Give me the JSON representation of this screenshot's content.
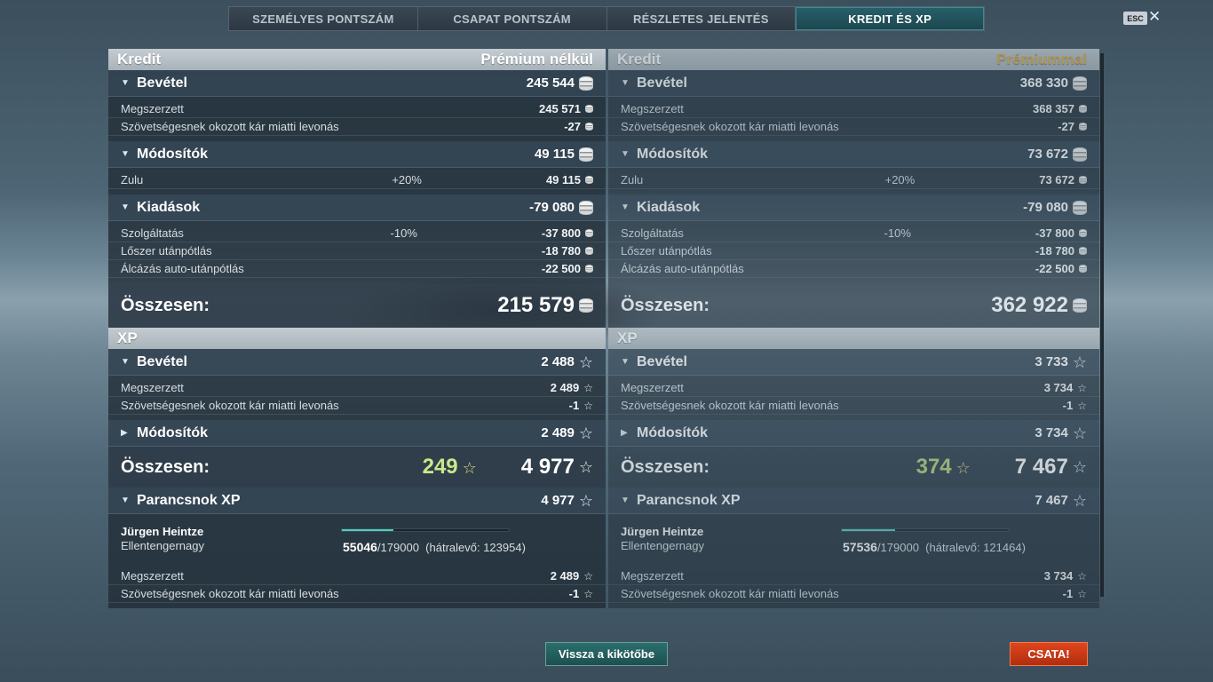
{
  "tabs": [
    {
      "label": "SZEMÉLYES PONTSZÁM",
      "active": false
    },
    {
      "label": "CSAPAT PONTSZÁM",
      "active": false
    },
    {
      "label": "RÉSZLETES JELENTÉS",
      "active": false
    },
    {
      "label": "KREDIT ÉS XP",
      "active": true
    }
  ],
  "esc": "ESC",
  "close": "✕",
  "panels": [
    {
      "kredit_title": "Kredit",
      "premium_label": "Prémium nélkül",
      "income": {
        "label": "Bevétel",
        "value": "245 544",
        "rows": [
          {
            "label": "Megszerzett",
            "value": "245 571"
          },
          {
            "label": "Szövetségesnek okozott kár miatti levonás",
            "value": "-27"
          }
        ]
      },
      "modifiers": {
        "label": "Módosítók",
        "value": "49 115",
        "rows": [
          {
            "label": "Zulu",
            "pct": "+20%",
            "value": "49 115"
          }
        ]
      },
      "expenses": {
        "label": "Kiadások",
        "value": "-79 080",
        "rows": [
          {
            "label": "Szolgáltatás",
            "pct": "-10%",
            "value": "-37 800"
          },
          {
            "label": "Lőszer utánpótlás",
            "pct": "",
            "value": "-18 780"
          },
          {
            "label": "Álcázás auto-utánpótlás",
            "pct": "",
            "value": "-22 500"
          }
        ]
      },
      "total_label": "Összesen:",
      "total_value": "215 579",
      "xp_title": "XP",
      "xp_income": {
        "label": "Bevétel",
        "value": "2 488",
        "rows": [
          {
            "label": "Megszerzett",
            "value": "2 489"
          },
          {
            "label": "Szövetségesnek okozott kár miatti levonás",
            "value": "-1"
          }
        ]
      },
      "xp_modifiers": {
        "label": "Módosítók",
        "value": "2 489"
      },
      "xp_total_label": "Összesen:",
      "xp_free": "249",
      "xp_total": "4 977",
      "commander": {
        "label": "Parancsnok XP",
        "value": "4 977",
        "name": "Jürgen Heintze",
        "rank": "Ellentengernagy",
        "xp_current": "55046",
        "xp_max": "/179000",
        "xp_remaining": "(hátralevő: 123954)",
        "progress": 0.307,
        "rows": [
          {
            "label": "Megszerzett",
            "value": "2 489"
          },
          {
            "label": "Szövetségesnek okozott kár miatti levonás",
            "value": "-1"
          }
        ]
      }
    },
    {
      "kredit_title": "Kredit",
      "premium_label": "Prémiummal",
      "income": {
        "label": "Bevétel",
        "value": "368 330",
        "rows": [
          {
            "label": "Megszerzett",
            "value": "368 357"
          },
          {
            "label": "Szövetségesnek okozott kár miatti levonás",
            "value": "-27"
          }
        ]
      },
      "modifiers": {
        "label": "Módosítók",
        "value": "73 672",
        "rows": [
          {
            "label": "Zulu",
            "pct": "+20%",
            "value": "73 672"
          }
        ]
      },
      "expenses": {
        "label": "Kiadások",
        "value": "-79 080",
        "rows": [
          {
            "label": "Szolgáltatás",
            "pct": "-10%",
            "value": "-37 800"
          },
          {
            "label": "Lőszer utánpótlás",
            "pct": "",
            "value": "-18 780"
          },
          {
            "label": "Álcázás auto-utánpótlás",
            "pct": "",
            "value": "-22 500"
          }
        ]
      },
      "total_label": "Összesen:",
      "total_value": "362 922",
      "xp_title": "XP",
      "xp_income": {
        "label": "Bevétel",
        "value": "3 733",
        "rows": [
          {
            "label": "Megszerzett",
            "value": "3 734"
          },
          {
            "label": "Szövetségesnek okozott kár miatti levonás",
            "value": "-1"
          }
        ]
      },
      "xp_modifiers": {
        "label": "Módosítók",
        "value": "3 734"
      },
      "xp_total_label": "Összesen:",
      "xp_free": "374",
      "xp_total": "7 467",
      "commander": {
        "label": "Parancsnok XP",
        "value": "7 467",
        "name": "Jürgen Heintze",
        "rank": "Ellentengernagy",
        "xp_current": "57536",
        "xp_max": "/179000",
        "xp_remaining": "(hátralevő: 121464)",
        "progress": 0.321,
        "rows": [
          {
            "label": "Megszerzett",
            "value": "3 734"
          },
          {
            "label": "Szövetségesnek okozott kár miatti levonás",
            "value": "-1"
          }
        ]
      }
    }
  ],
  "buttons": {
    "back": "Vissza a kikötőbe",
    "battle": "CSATA!"
  },
  "icons": {
    "credit": "credit-coin-icon",
    "xp": "xp-star-icon",
    "expand": "triangle-down-icon",
    "collapsed": "triangle-right-icon"
  },
  "colors": {
    "accent_tab": "#1d4650",
    "battle_button": "#c9371a",
    "back_button": "#23605e",
    "premium_gold": "#d8b25a",
    "free_xp": "#cbe68a"
  }
}
